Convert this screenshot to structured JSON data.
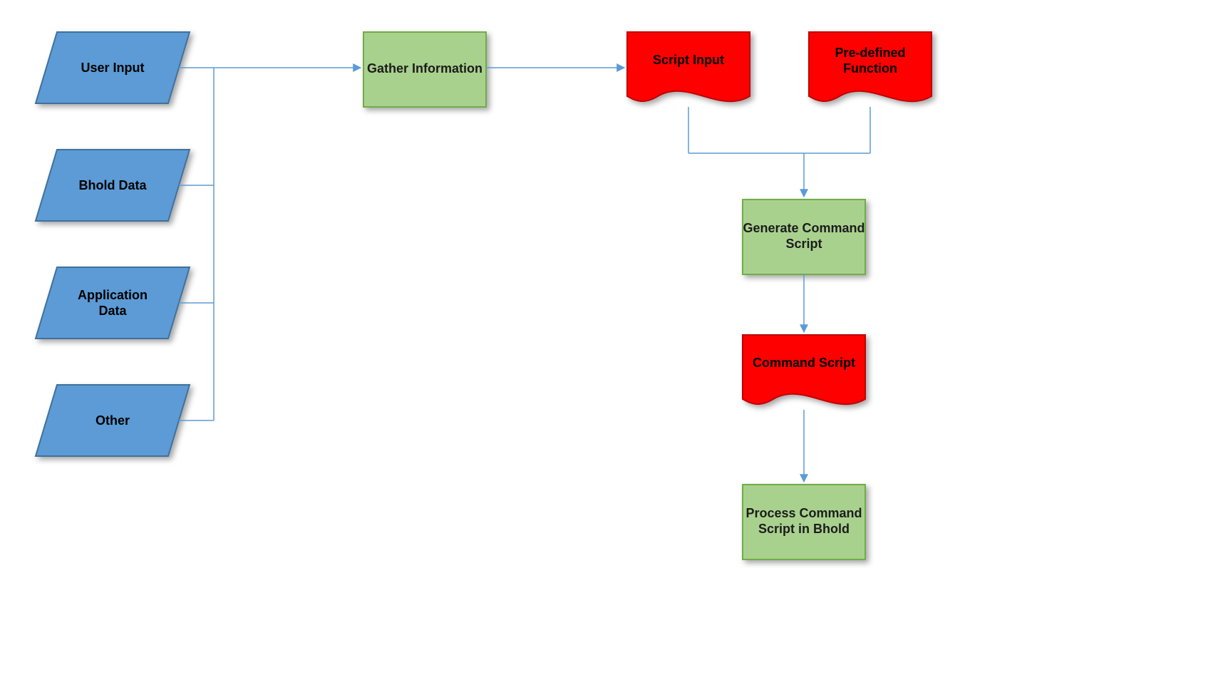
{
  "inputs": {
    "user_input": "User Input",
    "bhold_data": "Bhold Data",
    "application_data_line1": "Application",
    "application_data_line2": "Data",
    "other": "Other"
  },
  "processes": {
    "gather_info": "Gather Information",
    "generate_cmd_line1": "Generate Command",
    "generate_cmd_line2": "Script",
    "process_cmd_line1": "Process Command",
    "process_cmd_line2": "Script in Bhold"
  },
  "documents": {
    "script_input": "Script Input",
    "predefined_line1": "Pre-defined",
    "predefined_line2": "Function",
    "command_script": "Command Script"
  },
  "colors": {
    "blue_fill": "#5b9bd5",
    "blue_stroke": "#41719c",
    "green_fill": "#a9d18e",
    "green_stroke": "#70ad47",
    "red_fill": "#ff0000",
    "red_stroke": "#c00000",
    "connector": "#5b9bd5",
    "shadow": "rgba(0,0,0,0.35)"
  }
}
